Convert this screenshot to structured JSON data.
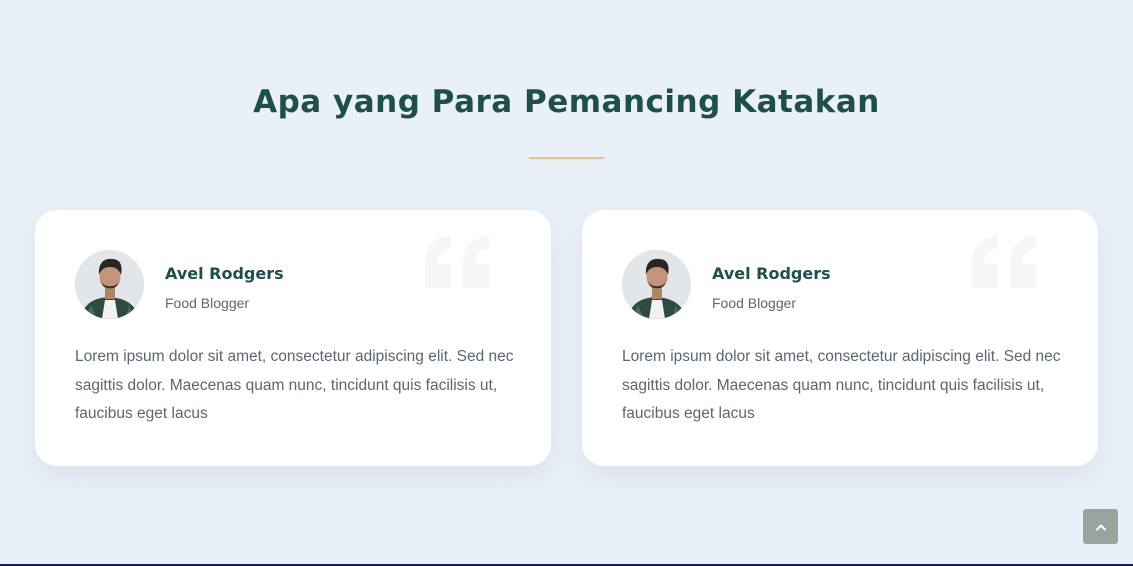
{
  "section": {
    "title": "Apa yang Para Pemancing Katakan"
  },
  "testimonials": [
    {
      "name": "Avel Rodgers",
      "role": "Food Blogger",
      "text": "Lorem ipsum dolor sit amet, consectetur adipiscing elit. Sed nec sagittis dolor. Maecenas quam nunc, tincidunt quis facilisis ut, faucibus eget lacus",
      "avatar_icon": "person-photo",
      "quote_icon": "quote-icon"
    },
    {
      "name": "Avel Rodgers",
      "role": "Food Blogger",
      "text": "Lorem ipsum dolor sit amet, consectetur adipiscing elit. Sed nec sagittis dolor. Maecenas quam nunc, tincidunt quis facilisis ut, faucibus eget lacus",
      "avatar_icon": "person-photo",
      "quote_icon": "quote-icon"
    }
  ],
  "back_to_top": {
    "icon": "chevron-up-icon"
  },
  "colors": {
    "background": "#eaf0f8",
    "title": "#1f4f4a",
    "divider_accent": "#f4c27a",
    "card": "#ffffff",
    "body_text": "#5a6670",
    "back_to_top_bg": "#9aa39e"
  }
}
